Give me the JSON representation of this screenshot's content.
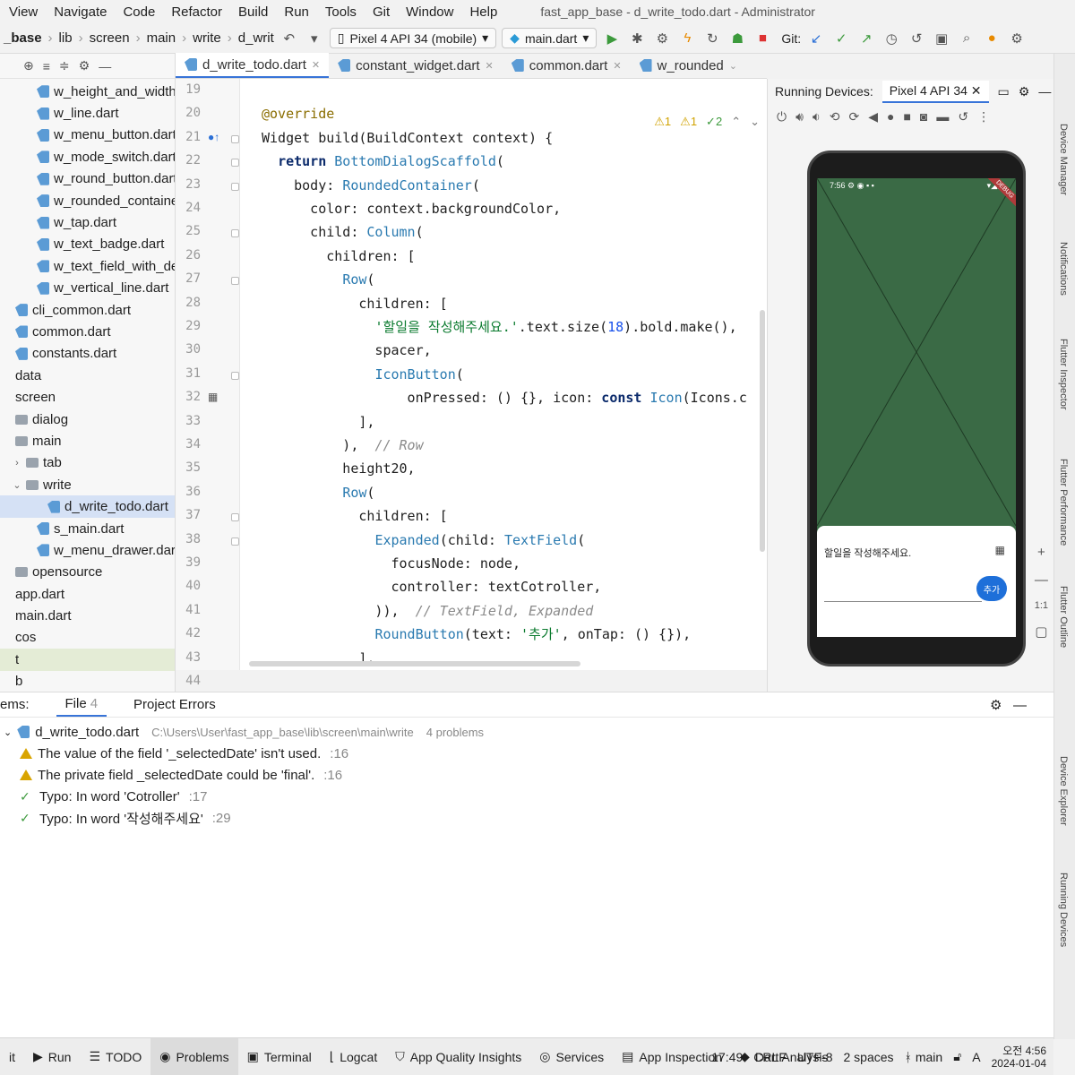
{
  "menu": {
    "items": [
      "View",
      "Navigate",
      "Code",
      "Refactor",
      "Build",
      "Run",
      "Tools",
      "Git",
      "Window",
      "Help"
    ],
    "window_title": "fast_app_base - d_write_todo.dart - Administrator"
  },
  "breadcrumb": [
    "_base",
    "lib",
    "screen",
    "main",
    "write",
    "d_writ"
  ],
  "toolbar": {
    "device": "Pixel 4 API 34 (mobile)",
    "run_config": "main.dart",
    "git_label": "Git:"
  },
  "tabs": [
    "d_write_todo.dart",
    "constant_widget.dart",
    "common.dart",
    "w_rounded"
  ],
  "project_tree": [
    {
      "label": "w_height_and_width.c",
      "kind": "dart",
      "indent": 2
    },
    {
      "label": "w_line.dart",
      "kind": "dart",
      "indent": 2
    },
    {
      "label": "w_menu_button.dart",
      "kind": "dart",
      "indent": 2
    },
    {
      "label": "w_mode_switch.dart",
      "kind": "dart",
      "indent": 2
    },
    {
      "label": "w_round_button.dart",
      "kind": "dart",
      "indent": 2
    },
    {
      "label": "w_rounded_container.",
      "kind": "dart",
      "indent": 2
    },
    {
      "label": "w_tap.dart",
      "kind": "dart",
      "indent": 2
    },
    {
      "label": "w_text_badge.dart",
      "kind": "dart",
      "indent": 2
    },
    {
      "label": "w_text_field_with_dele",
      "kind": "dart",
      "indent": 2
    },
    {
      "label": "w_vertical_line.dart",
      "kind": "dart",
      "indent": 2
    },
    {
      "label": "cli_common.dart",
      "kind": "dart",
      "indent": 0
    },
    {
      "label": "common.dart",
      "kind": "dart",
      "indent": 0
    },
    {
      "label": "constants.dart",
      "kind": "dart",
      "indent": 0
    },
    {
      "label": "data",
      "kind": "none",
      "indent": 0
    },
    {
      "label": "screen",
      "kind": "none",
      "indent": 0
    },
    {
      "label": "dialog",
      "kind": "folder",
      "indent": 0
    },
    {
      "label": "main",
      "kind": "folder",
      "indent": 0
    },
    {
      "label": "tab",
      "kind": "folder",
      "indent": 1,
      "arrow": ">"
    },
    {
      "label": "write",
      "kind": "folder",
      "indent": 1,
      "arrow": "v"
    },
    {
      "label": "d_write_todo.dart",
      "kind": "dart",
      "indent": 3,
      "selected": true
    },
    {
      "label": "s_main.dart",
      "kind": "dart",
      "indent": 2
    },
    {
      "label": "w_menu_drawer.dart",
      "kind": "dart",
      "indent": 2
    },
    {
      "label": "opensource",
      "kind": "folder",
      "indent": 0
    },
    {
      "label": "app.dart",
      "kind": "none",
      "indent": 0
    },
    {
      "label": "main.dart",
      "kind": "none",
      "indent": 0
    },
    {
      "label": "cos",
      "kind": "none",
      "indent": 0
    },
    {
      "label": "t",
      "kind": "none",
      "indent": 0,
      "highlight": true
    },
    {
      "label": "b",
      "kind": "none",
      "indent": 0
    }
  ],
  "line_numbers": [
    "19",
    "20",
    "21",
    "22",
    "23",
    "24",
    "25",
    "26",
    "27",
    "28",
    "29",
    "30",
    "31",
    "32",
    "33",
    "34",
    "35",
    "36",
    "37",
    "38",
    "39",
    "40",
    "41",
    "42",
    "43",
    "44"
  ],
  "inspections": {
    "warnings": "1",
    "weak_warnings": "1",
    "typos": "2"
  },
  "code_lines": [
    "",
    "@override",
    "Widget build(BuildContext context) {",
    "  return BottomDialogScaffold(",
    "    body: RoundedContainer(",
    "      color: context.backgroundColor,",
    "      child: Column(",
    "        children: [",
    "          Row(",
    "            children: [",
    "              '할일을 작성해주세요.'.text.size(18).bold.make(),",
    "              spacer,",
    "              IconButton(",
    "                  onPressed: () {}, icon: const Icon(Icons.c",
    "            ],",
    "          ),  // Row",
    "          height20,",
    "          Row(",
    "            children: [",
    "              Expanded(child: TextField(",
    "                focusNode: node,",
    "                controller: textCotroller,",
    "              )),  // TextField, Expanded",
    "              RoundButton(text: '추가', onTap: () {}),",
    "            ],",
    "          )  // Row"
  ],
  "devices": {
    "panel_title": "Running Devices:",
    "tab": "Pixel 4 API 34",
    "status_time": "7:56",
    "debug_badge": "DEBUG"
  },
  "app": {
    "sheet_title": "할일을 작성해주세요.",
    "add_button": "추가"
  },
  "side_tools": [
    "Device Manager",
    "Notifications",
    "Flutter Inspector",
    "Flutter Performance",
    "Flutter Outline",
    "Device Explorer",
    "Running Devices"
  ],
  "problems": {
    "tabs": [
      "ems:",
      "File",
      "Project Errors"
    ],
    "file_count": "4",
    "file": "d_write_todo.dart",
    "path": "C:\\Users\\User\\fast_app_base\\lib\\screen\\main\\write",
    "summary": "4 problems",
    "items": [
      {
        "type": "warning",
        "text": "The value of the field '_selectedDate' isn't used.",
        "line": ":16"
      },
      {
        "type": "warning",
        "text": "The private field _selectedDate could be 'final'.",
        "line": ":16"
      },
      {
        "type": "typo",
        "text": "Typo: In word 'Cotroller'",
        "line": ":17"
      },
      {
        "type": "typo",
        "text": "Typo: In word '작성해주세요'",
        "line": ":29"
      }
    ]
  },
  "bottom_tabs": [
    "it",
    "Run",
    "TODO",
    "Problems",
    "Terminal",
    "Logcat",
    "App Quality Insights",
    "Services",
    "App Inspection",
    "Dart Analysis"
  ],
  "status": {
    "position": "17:49",
    "line_sep": "CRLF",
    "encoding": "UTF-8",
    "indent": "2 spaces",
    "branch": "main"
  },
  "system_tray": {
    "ime": "A",
    "time": "오전 4:56",
    "date": "2024-01-04"
  }
}
